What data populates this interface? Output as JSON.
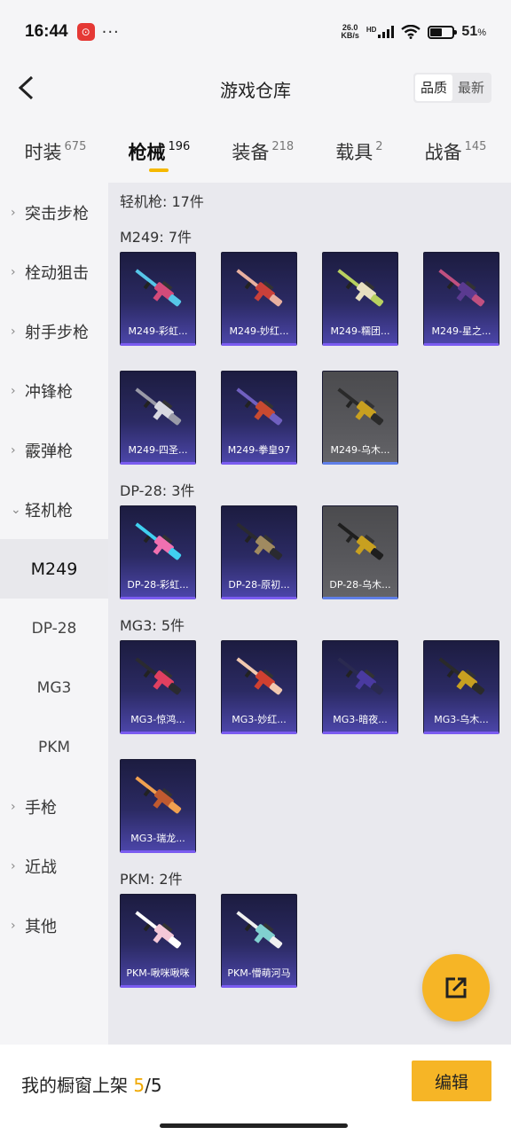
{
  "status": {
    "time": "16:44",
    "dots": "···",
    "net_speed_top": "26.0",
    "net_speed_bottom": "KB/s",
    "hd": "HD",
    "battery": "51",
    "battery_unit": "%",
    "battery_level": 0.51
  },
  "header": {
    "title": "游戏仓库",
    "sort_quality": "品质",
    "sort_latest": "最新"
  },
  "tabs": [
    {
      "label": "时装",
      "count": "675"
    },
    {
      "label": "枪械",
      "count": "196"
    },
    {
      "label": "装备",
      "count": "218"
    },
    {
      "label": "载具",
      "count": "2"
    },
    {
      "label": "战备",
      "count": "145"
    }
  ],
  "sidebar": [
    {
      "label": "突击步枪"
    },
    {
      "label": "栓动狙击"
    },
    {
      "label": "射手步枪"
    },
    {
      "label": "冲锋枪"
    },
    {
      "label": "霰弹枪"
    },
    {
      "label": "轻机枪"
    },
    {
      "label": "M249"
    },
    {
      "label": "DP-28"
    },
    {
      "label": "MG3"
    },
    {
      "label": "PKM"
    },
    {
      "label": "手枪"
    },
    {
      "label": "近战"
    },
    {
      "label": "其他"
    }
  ],
  "content": {
    "section_title": "轻机枪: 17件",
    "groups": [
      {
        "title": "M249: 7件",
        "items": [
          "M249-彩虹...",
          "M249-妙红...",
          "M249-糯团...",
          "M249-星之...",
          "M249-四圣...",
          "M249-拳皇97",
          "M249-乌木..."
        ]
      },
      {
        "title": "DP-28: 3件",
        "items": [
          "DP-28-彩虹...",
          "DP-28-原初...",
          "DP-28-乌木..."
        ]
      },
      {
        "title": "MG3: 5件",
        "items": [
          "MG3-惊鸿...",
          "MG3-妙红...",
          "MG3-暗夜...",
          "MG3-乌木...",
          "MG3-瑞龙..."
        ]
      },
      {
        "title": "PKM: 2件",
        "items": [
          "PKM-啾咪啾咪",
          "PKM-懵萌河马"
        ]
      }
    ]
  },
  "bottom": {
    "shelf_label": "我的橱窗上架",
    "shelf_used": "5",
    "shelf_total": "/5",
    "edit_label": "编辑"
  },
  "colors": {
    "accent": "#f6b526",
    "card_dark": "#2b2a63",
    "card_grey": "#58585c"
  }
}
